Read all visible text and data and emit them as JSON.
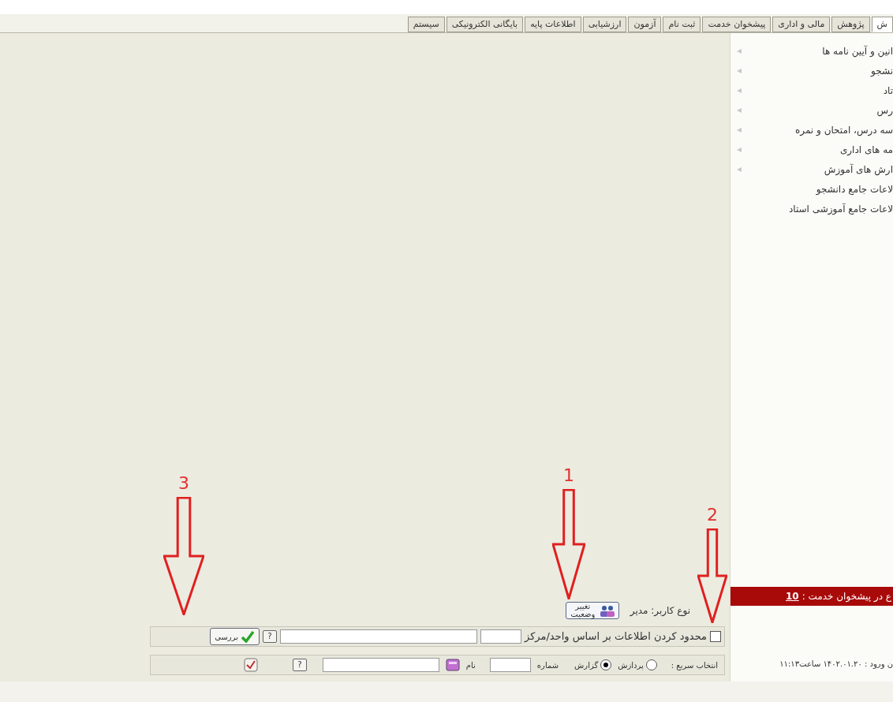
{
  "tabs": [
    {
      "label": "ش",
      "selected": true
    },
    {
      "label": "پژوهش",
      "selected": false
    },
    {
      "label": "مالی و اداری",
      "selected": false
    },
    {
      "label": "پیشخوان خدمت",
      "selected": false
    },
    {
      "label": "ثبت نام",
      "selected": false
    },
    {
      "label": "آزمون",
      "selected": false
    },
    {
      "label": "ارزشیابی",
      "selected": false
    },
    {
      "label": "اطلاعات پایه",
      "selected": false
    },
    {
      "label": "بایگانی الکترونیکی",
      "selected": false
    },
    {
      "label": "سیستم",
      "selected": false
    }
  ],
  "sidebar": {
    "items": [
      {
        "label": "انین و آیین نامه ها",
        "kind": "submenu"
      },
      {
        "label": "نشجو",
        "kind": "submenu"
      },
      {
        "label": "تاد",
        "kind": "submenu"
      },
      {
        "label": "رس",
        "kind": "submenu"
      },
      {
        "label": "سه درس، امتحان و نمره",
        "kind": "submenu"
      },
      {
        "label": "مه های اداری",
        "kind": "submenu"
      },
      {
        "label": "ارش های آموزش",
        "kind": "submenu"
      },
      {
        "label": "لاعات جامع دانشجو",
        "kind": "link"
      },
      {
        "label": "لاعات جامع آموزشی استاد",
        "kind": "link"
      }
    ],
    "banner": {
      "text": "ع در پیشخوان خدمت :",
      "count": "10"
    },
    "login_info": "ن ورود : ۱۴۰۲.۰۱.۲۰ ساعت۱۱:۱۳"
  },
  "user_type": {
    "label": "نوع کاربر: مدیر",
    "change_button": "تغییر وضعیت"
  },
  "filter": {
    "checked": false,
    "label": "محدود کردن اطلاعات بر اساس واحد/مرکز",
    "help": "?",
    "check_button": "بررسی"
  },
  "quick_select": {
    "label": "انتخاب سریع :",
    "options": [
      {
        "label": "پردازش",
        "selected": false
      },
      {
        "label": "گزارش",
        "selected": true
      }
    ],
    "number_label": "شماره",
    "name_label": "نام",
    "help": "?"
  },
  "annotations": [
    "1",
    "2",
    "3"
  ]
}
